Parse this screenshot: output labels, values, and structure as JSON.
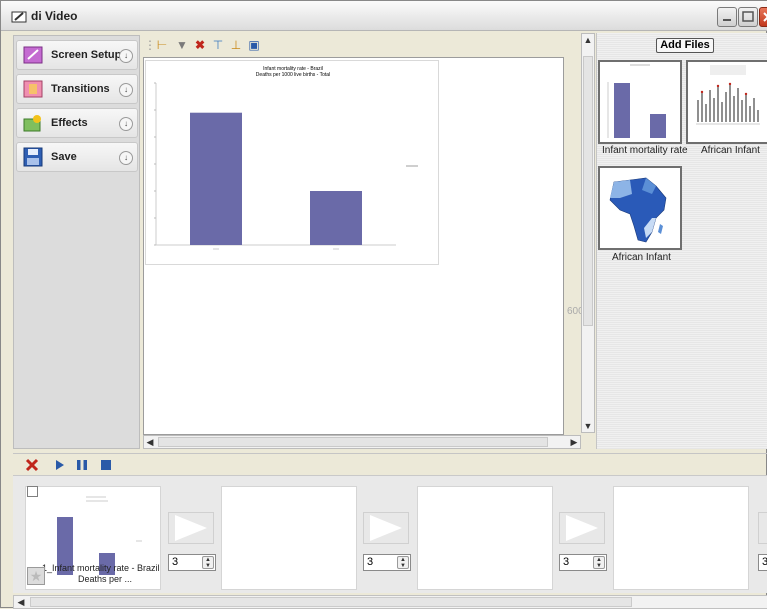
{
  "window": {
    "title": "di Video"
  },
  "sidebar": {
    "items": [
      {
        "label": "Screen Setup",
        "icon": "screen-setup-icon"
      },
      {
        "label": "Transitions",
        "icon": "transitions-icon"
      },
      {
        "label": "Effects",
        "icon": "effects-icon"
      },
      {
        "label": "Save",
        "icon": "save-icon"
      }
    ]
  },
  "canvas": {
    "ruler_label": "600",
    "chart": {
      "title": "Infant mortality rate - Brazil",
      "subtitle": "Deaths per 1000 live births - Total"
    }
  },
  "chart_data": {
    "type": "bar",
    "categories": [
      "",
      ""
    ],
    "values": [
      49,
      20
    ],
    "title": "Infant mortality rate - Brazil",
    "subtitle": "Deaths per 1000 live births - Total",
    "ylim": [
      0,
      60
    ],
    "colors": [
      "#6a6aa8"
    ]
  },
  "right_panel": {
    "add_files_label": "Add Files",
    "files": [
      {
        "caption": "Infant mortality rate"
      },
      {
        "caption": "African Infant"
      },
      {
        "caption": "African Infant"
      }
    ]
  },
  "timeline": {
    "slides": [
      {
        "caption_line1": "1_Infant mortality rate - Brazil",
        "caption_line2": "Deaths per ..."
      }
    ],
    "durations": [
      "3",
      "3",
      "3",
      "3"
    ]
  },
  "colors": {
    "bar": "#6a6aa8",
    "delete_red": "#c0261c",
    "play_blue": "#2a5aa8"
  }
}
